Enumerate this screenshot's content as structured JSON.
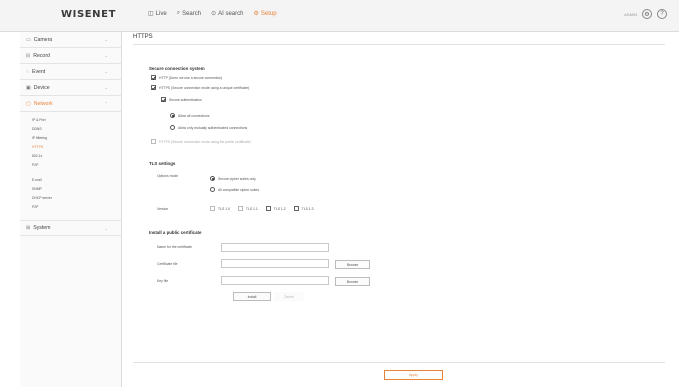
{
  "brand": "WISENET",
  "topnav": [
    {
      "label": "Live",
      "icon": "live-icon",
      "glyph": "◫"
    },
    {
      "label": "Search",
      "icon": "search-icon",
      "glyph": "⌕"
    },
    {
      "label": "AI search",
      "icon": "ai-search-icon",
      "glyph": "⊙"
    },
    {
      "label": "Setup",
      "icon": "setup-icon",
      "glyph": "⚙"
    }
  ],
  "topright": {
    "user": "ADMIN"
  },
  "sidebar": {
    "menus": [
      {
        "label": "Camera",
        "icon": "camera-icon"
      },
      {
        "label": "Record",
        "icon": "record-icon"
      },
      {
        "label": "Event",
        "icon": "event-icon"
      },
      {
        "label": "Device",
        "icon": "device-icon"
      },
      {
        "label": "Network",
        "icon": "network-icon"
      },
      {
        "label": "System",
        "icon": "system-icon"
      }
    ],
    "network_items": [
      "IP & Port",
      "DDNS",
      "IP filtering",
      "HTTPS",
      "802.1x",
      "P2P",
      "E-mail",
      "SNMP",
      "DHCP server",
      "P2P"
    ]
  },
  "page": {
    "title": "HTTPS"
  },
  "secure": {
    "heading": "Secure connection system",
    "opt1": "HTTP (Does not use a secure connection)",
    "opt2": "HTTPS (Secure connection mode using a unique certificate)",
    "opt2_sub": "Secure authentication",
    "radio1": "Allow all connections",
    "radio2": "Allow only mutually authenticated connections",
    "opt3": "HTTPS (Secure connection mode using the public certificate)"
  },
  "tls": {
    "heading": "TLS settings",
    "mode_label": "Options mode",
    "mode1": "Secure cipher suites only",
    "mode2": "All compatible cipher suites",
    "version_label": "Version",
    "versions": [
      "TLS 1.0",
      "TLS 1.1",
      "TLS 1.2",
      "TLS 1.3"
    ]
  },
  "cert": {
    "heading": "Install a public certificate",
    "name_label": "Name for the certificate",
    "cert_label": "Certificate file",
    "key_label": "Key file",
    "browse": "Browse",
    "install": "Install",
    "delete": "Delete"
  },
  "footer": {
    "apply": "Apply"
  }
}
